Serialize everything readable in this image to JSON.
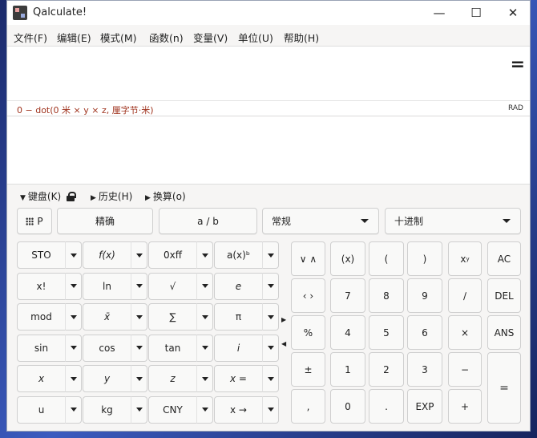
{
  "window": {
    "title": "Qalculate!",
    "minimize": "—",
    "maximize": "☐",
    "close": "✕"
  },
  "menu": [
    "文件(F)",
    "编辑(E)",
    "模式(M)",
    "函数(n)",
    "变量(V)",
    "单位(U)",
    "帮助(H)"
  ],
  "parse": {
    "text": "0 − dot(0 米 × y × z, 厘字节·米)",
    "angle": "RAD"
  },
  "tabs": {
    "keypad": "键盘(K)",
    "history": "历史(H)",
    "conversion": "换算(o)"
  },
  "toolbar": {
    "programming": "P",
    "exact": "精确",
    "fraction": "a / b",
    "mode": "常规",
    "base": "十进制"
  },
  "function_keys": [
    [
      "STO",
      "f(x)",
      "0xff",
      "a(x)ᵇ"
    ],
    [
      "x!",
      "ln",
      "√",
      "e"
    ],
    [
      "mod",
      "x̄",
      "∑",
      "π"
    ],
    [
      "sin",
      "cos",
      "tan",
      "i"
    ],
    [
      "x",
      "y",
      "z",
      "x ="
    ],
    [
      "u",
      "kg",
      "CNY",
      "x →"
    ]
  ],
  "numpad": {
    "r0": [
      "(x)",
      "(",
      ")",
      "x^y",
      "AC"
    ],
    "r1": [
      "7",
      "8",
      "9",
      "∕",
      "DEL"
    ],
    "r2": [
      "4",
      "5",
      "6",
      "×",
      "ANS"
    ],
    "r3": [
      "1",
      "2",
      "3",
      "−"
    ],
    "r4": [
      "0",
      ".",
      "EXP",
      "+"
    ],
    "left": [
      "%",
      "±",
      ","
    ],
    "equals": "=",
    "xy_base": "x",
    "xy_exp": "y"
  },
  "nav": {
    "up_down": "∨ ∧",
    "left_right": "‹ ›"
  }
}
